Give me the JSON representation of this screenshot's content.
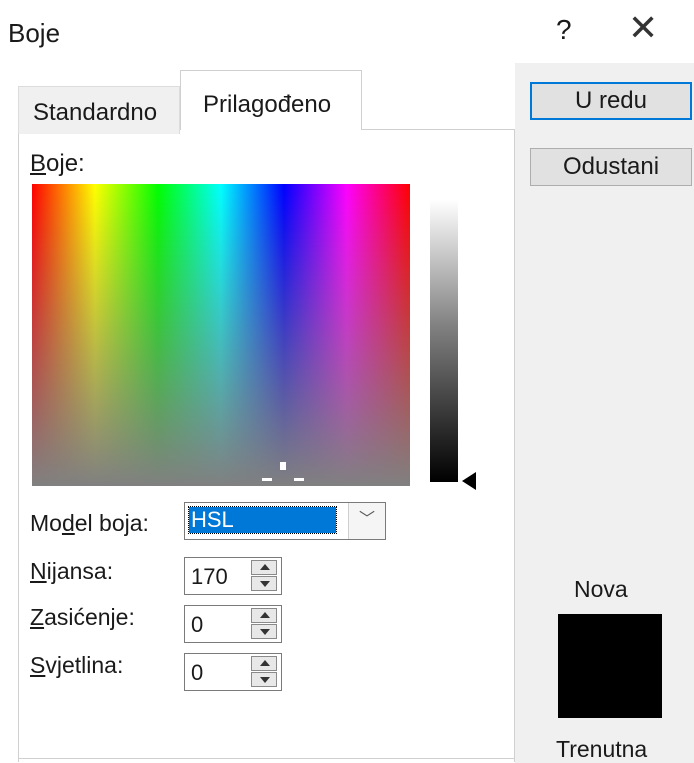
{
  "window": {
    "title": "Boje",
    "help": "?",
    "close": "✕"
  },
  "tabs": [
    {
      "label": "Standardno",
      "active": false
    },
    {
      "label": "Prilagođeno",
      "active": true
    }
  ],
  "buttons": {
    "ok": "U redu",
    "cancel": "Odustani"
  },
  "colors_label": {
    "accel": "B",
    "rest": "oje:"
  },
  "model": {
    "label_pre": "Mo",
    "label_accel": "d",
    "label_post": "el boja:",
    "value": "HSL"
  },
  "fields": [
    {
      "accel": "N",
      "rest": "ijansa:",
      "value": "170"
    },
    {
      "accel": "Z",
      "rest": "asićenje:",
      "value": "0"
    },
    {
      "accel": "S",
      "rest": "vjetlina:",
      "value": "0"
    }
  ],
  "preview": {
    "new_label": "Nova",
    "current_label": "Trenutna",
    "new_color": "#000000"
  }
}
